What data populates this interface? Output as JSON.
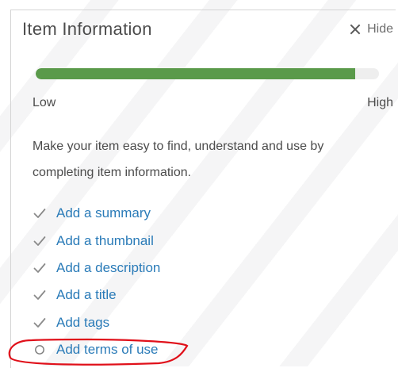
{
  "panel": {
    "title": "Item Information",
    "hide_label": "Hide",
    "progress_fraction": 0.93,
    "progress_color": "#5a9a4a",
    "scale_low": "Low",
    "scale_high": "High",
    "description": "Make your item easy to find, understand and use by completing item information.",
    "checklist": [
      {
        "label": "Add a summary",
        "done": true
      },
      {
        "label": "Add a thumbnail",
        "done": true
      },
      {
        "label": "Add a description",
        "done": true
      },
      {
        "label": "Add a title",
        "done": true
      },
      {
        "label": "Add tags",
        "done": true
      },
      {
        "label": "Add terms of use",
        "done": false
      }
    ],
    "link_color": "#2a7bb8",
    "annotation_color": "#e0101a"
  }
}
